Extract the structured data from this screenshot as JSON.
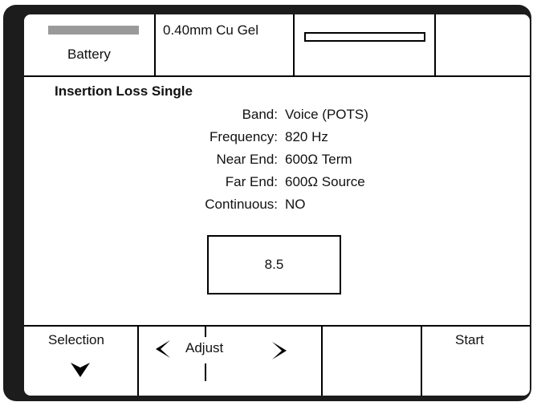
{
  "status_bar": {
    "battery_label": "Battery",
    "cable_type": "0.40mm Cu Gel",
    "progress": 0
  },
  "test": {
    "title": "Insertion Loss Single",
    "params": [
      {
        "key": "Band:",
        "value": "Voice (POTS)"
      },
      {
        "key": "Frequency:",
        "value": "820 Hz"
      },
      {
        "key": "Near End:",
        "value": "600Ω Term"
      },
      {
        "key": "Far End:",
        "value": "600Ω Source"
      },
      {
        "key": "Continuous:",
        "value": "NO"
      }
    ],
    "result": "8.5"
  },
  "softkeys": {
    "selection_label": "Selection",
    "adjust_label": "Adjust",
    "start_label": "Start"
  },
  "icons": {
    "down": "chevron-down-icon",
    "left": "chevron-left-icon",
    "right": "chevron-right-icon"
  }
}
